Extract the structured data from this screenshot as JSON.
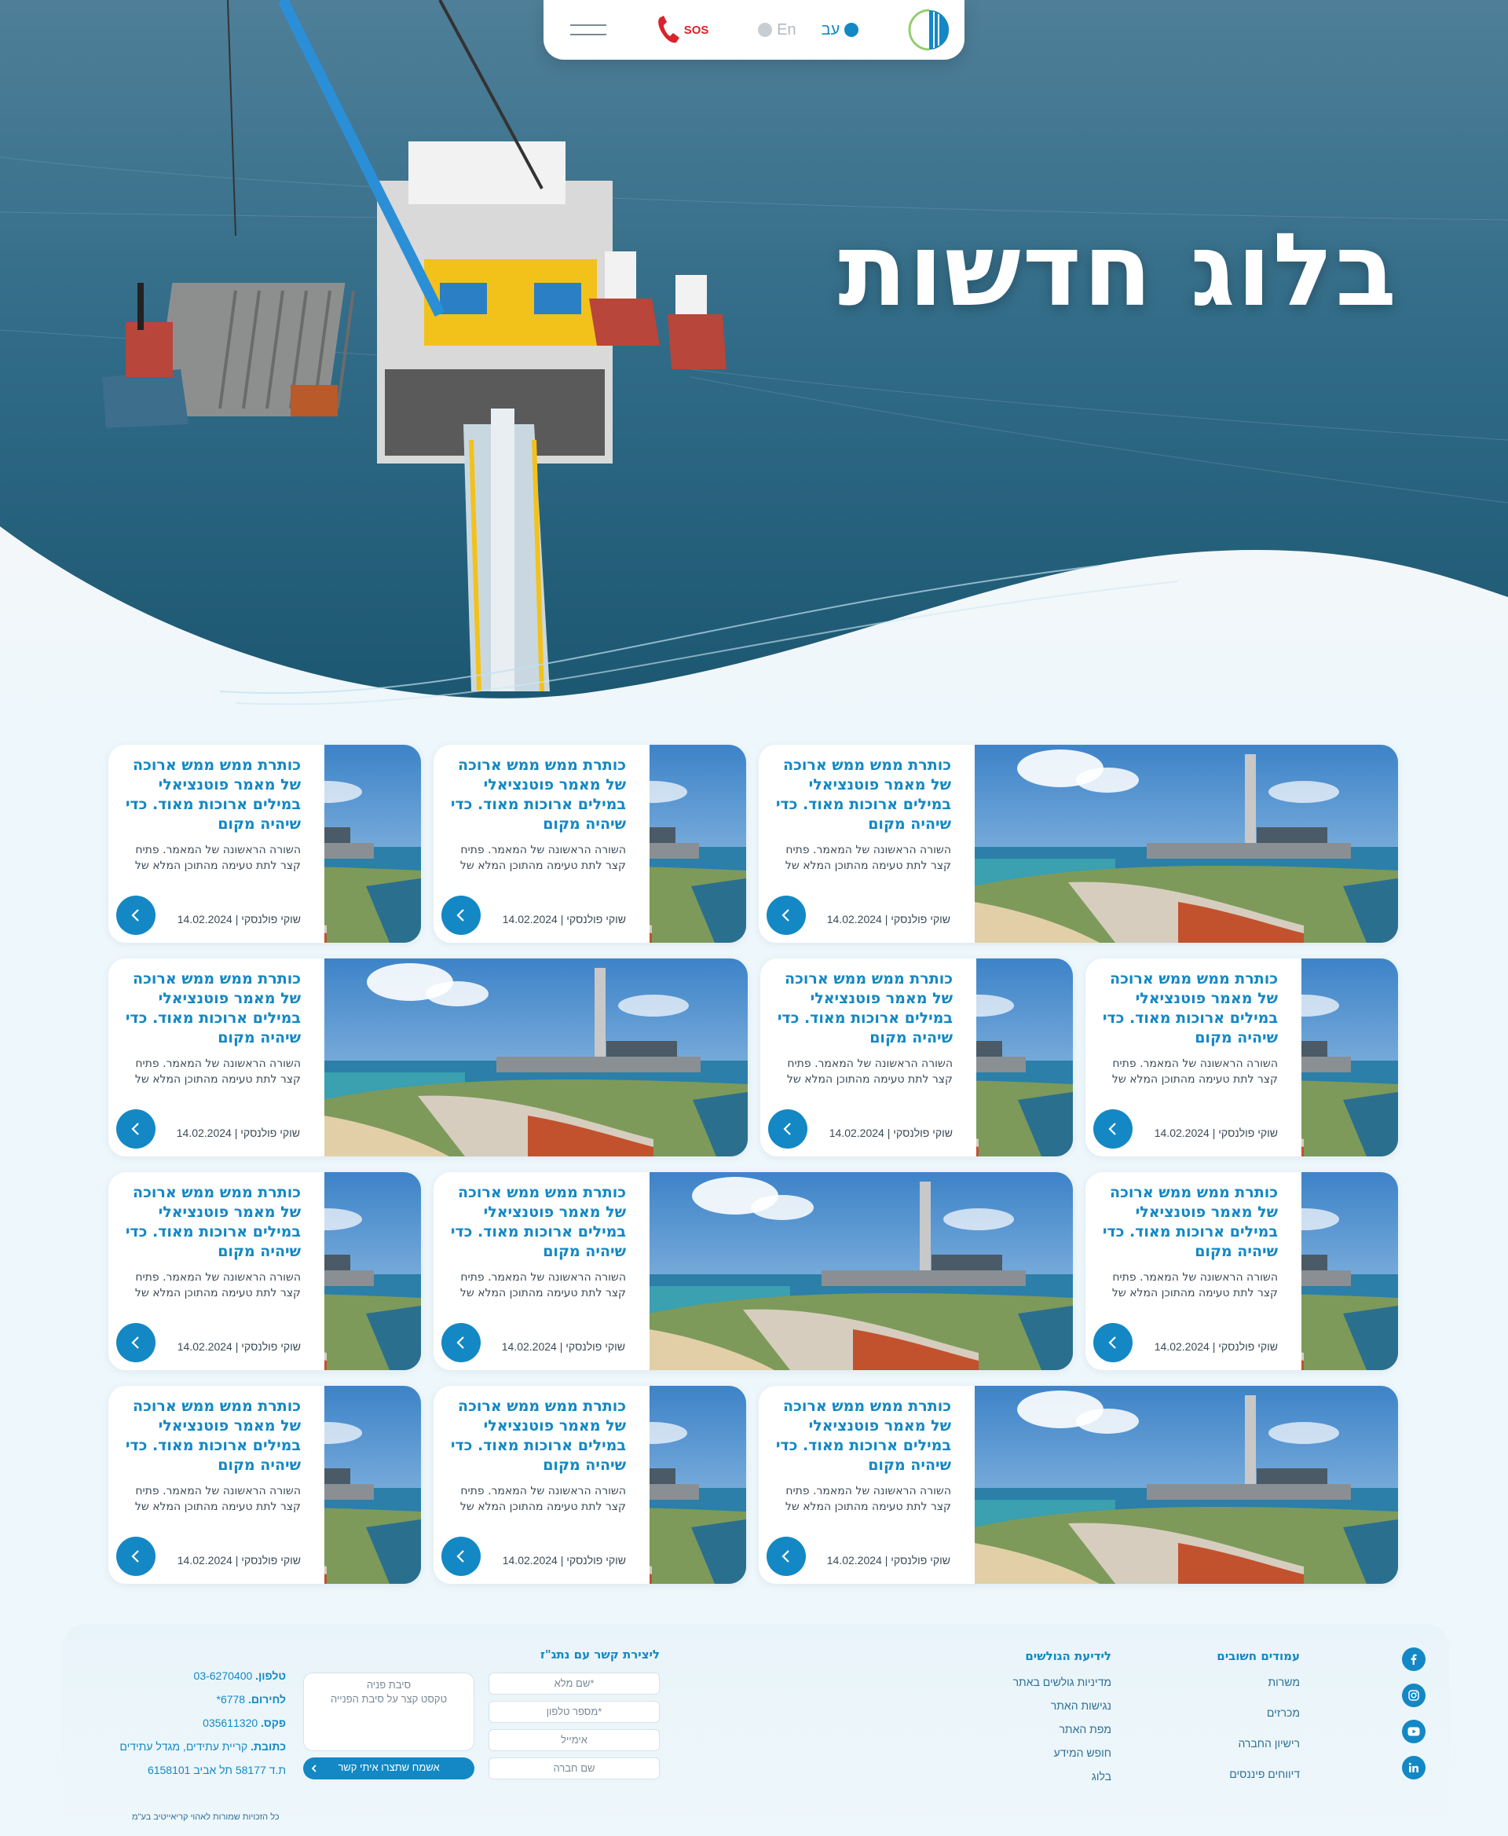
{
  "header": {
    "lang_he": "עב",
    "lang_en": "En",
    "sos_label": "SOS"
  },
  "hero": {
    "title": "בלוג חדשות"
  },
  "cards": [
    {
      "title": "כותרת ממש ממש ארוכה של מאמר פוטנציאלי במילים ארוכות מאוד. כדי שיהיה מקום",
      "excerpt": "השורה הראשונה של המאמר. פתיח קצר לתת טעימה מהתוכן המלא של",
      "author": "שוקי פולנסקי",
      "date": "14.02.2024"
    },
    {
      "title": "כותרת ממש ממש ארוכה של מאמר פוטנציאלי במילים ארוכות מאוד. כדי שיהיה מקום",
      "excerpt": "השורה הראשונה של המאמר. פתיח קצר לתת טעימה מהתוכן המלא של",
      "author": "שוקי פולנסקי",
      "date": "14.02.2024"
    },
    {
      "title": "כותרת ממש ממש ארוכה של מאמר פוטנציאלי במילים ארוכות מאוד. כדי שיהיה מקום",
      "excerpt": "השורה הראשונה של המאמר. פתיח קצר לתת טעימה מהתוכן המלא של",
      "author": "שוקי פולנסקי",
      "date": "14.02.2024"
    },
    {
      "title": "כותרת ממש ממש ארוכה של מאמר פוטנציאלי במילים ארוכות מאוד. כדי שיהיה מקום",
      "excerpt": "השורה הראשונה של המאמר. פתיח קצר לתת טעימה מהתוכן המלא של",
      "author": "שוקי פולנסקי",
      "date": "14.02.2024"
    },
    {
      "title": "כותרת ממש ממש ארוכה של מאמר פוטנציאלי במילים ארוכות מאוד. כדי שיהיה מקום",
      "excerpt": "השורה הראשונה של המאמר. פתיח קצר לתת טעימה מהתוכן המלא של",
      "author": "שוקי פולנסקי",
      "date": "14.02.2024"
    },
    {
      "title": "כותרת ממש ממש ארוכה של מאמר פוטנציאלי במילים ארוכות מאוד. כדי שיהיה מקום",
      "excerpt": "השורה הראשונה של המאמר. פתיח קצר לתת טעימה מהתוכן המלא של",
      "author": "שוקי פולנסקי",
      "date": "14.02.2024"
    },
    {
      "title": "כותרת ממש ממש ארוכה של מאמר פוטנציאלי במילים ארוכות מאוד. כדי שיהיה מקום",
      "excerpt": "השורה הראשונה של המאמר. פתיח קצר לתת טעימה מהתוכן המלא של",
      "author": "שוקי פולנסקי",
      "date": "14.02.2024"
    },
    {
      "title": "כותרת ממש ממש ארוכה של מאמר פוטנציאלי במילים ארוכות מאוד. כדי שיהיה מקום",
      "excerpt": "השורה הראשונה של המאמר. פתיח קצר לתת טעימה מהתוכן המלא של",
      "author": "שוקי פולנסקי",
      "date": "14.02.2024"
    },
    {
      "title": "כותרת ממש ממש ארוכה של מאמר פוטנציאלי במילים ארוכות מאוד. כדי שיהיה מקום",
      "excerpt": "השורה הראשונה של המאמר. פתיח קצר לתת טעימה מהתוכן המלא של",
      "author": "שוקי פולנסקי",
      "date": "14.02.2024"
    },
    {
      "title": "כותרת ממש ממש ארוכה של מאמר פוטנציאלי במילים ארוכות מאוד. כדי שיהיה מקום",
      "excerpt": "השורה הראשונה של המאמר. פתיח קצר לתת טעימה מהתוכן המלא של",
      "author": "שוקי פולנסקי",
      "date": "14.02.2024"
    },
    {
      "title": "כותרת ממש ממש ארוכה של מאמר פוטנציאלי במילים ארוכות מאוד. כדי שיהיה מקום",
      "excerpt": "השורה הראשונה של המאמר. פתיח קצר לתת טעימה מהתוכן המלא של",
      "author": "שוקי פולנסקי",
      "date": "14.02.2024"
    },
    {
      "title": "כותרת ממש ממש ארוכה של מאמר פוטנציאלי במילים ארוכות מאוד. כדי שיהיה מקום",
      "excerpt": "השורה הראשונה של המאמר. פתיח קצר לתת טעימה מהתוכן המלא של",
      "author": "שוקי פולנסקי",
      "date": "14.02.2024"
    }
  ],
  "footer": {
    "important_pages_title": "עמודים חשובים",
    "important_pages": [
      "משרות",
      "מכרזים",
      "רישיון החברה",
      "דיווחים פיננסים"
    ],
    "accessibility_title": "לידיעת הגולשים",
    "accessibility_links": [
      "מדיניות גולשים באתר",
      "נגישות האתר",
      "מפת האתר",
      "חופש המידע",
      "בלוג"
    ],
    "form_title": "ליצירת קשר עם נתג\"ז",
    "form": {
      "full_name": "*שם מלא",
      "phone": "*מספר טלפון",
      "email": "אימייל",
      "company": "שם חברה",
      "reason_label": "סיבת פניה",
      "reason_placeholder": "טקסט קצר על סיבת הפנייה",
      "submit": "אשמח שתצרו איתי קשר"
    },
    "contact": {
      "phone_label": "טלפון.",
      "phone": "03-6270400",
      "emergency_label": "לחירום.",
      "emergency": "6778*",
      "fax_label": "פקס.",
      "fax": "035611320",
      "address_label": "כתובת.",
      "address": "קריית עתידים, מגדל עתידים",
      "pobox": "ת.ד 58177 תל אביב 6158101"
    },
    "copyright": "כל הזכויות שמורות לאהוי קריאייטיב בע\"מ"
  },
  "colors": {
    "accent": "#1388c4",
    "sos": "#d9232a",
    "sea": "#1e5f7a"
  }
}
